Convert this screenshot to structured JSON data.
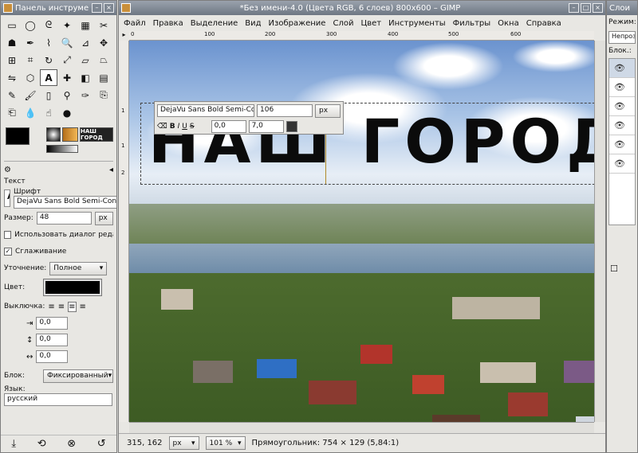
{
  "toolbox": {
    "title": "Панель инструме",
    "gradient_label": "НАШ ГОРОД",
    "options": {
      "section_title": "Текст",
      "font_label": "Шрифт",
      "font_value": "DejaVu Sans Bold Semi-Con",
      "size_label": "Размер:",
      "size_value": "48",
      "size_unit": "px",
      "use_dialog": "Использовать диалог редакт",
      "antialias": "Сглаживание",
      "hinting_label": "Уточнение:",
      "hinting_value": "Полное",
      "color_label": "Цвет:",
      "justify_label": "Выключка:",
      "indent_value": "0,0",
      "line_spacing_value": "0,0",
      "letter_spacing_value": "0,0",
      "box_label": "Блок:",
      "box_value": "Фиксированный",
      "language_label": "Язык:",
      "language_value": "русский"
    }
  },
  "image_window": {
    "title": "*Без имени-4.0 (Цвета RGB, 6 слоев) 800x600 – GIMP",
    "menu": [
      "Файл",
      "Правка",
      "Выделение",
      "Вид",
      "Изображение",
      "Слой",
      "Цвет",
      "Инструменты",
      "Фильтры",
      "Окна",
      "Справка"
    ],
    "ruler_ticks": [
      "0",
      "100",
      "200",
      "300",
      "400",
      "500",
      "600"
    ],
    "ruler_v_ticks": [
      "1",
      "1",
      "2"
    ],
    "canvas_text": "НАШ ГОРОД",
    "text_toolbar": {
      "font": "DejaVu Sans Bold Semi-Co",
      "size": "106",
      "unit": "px",
      "baseline": "0,0",
      "kerning": "7,0"
    },
    "status": {
      "coords": "315, 162",
      "unit": "px",
      "zoom": "101 %",
      "message": "Прямоугольник: 754 × 129  (5,84:1)"
    }
  },
  "layers_panel": {
    "title": "Слои",
    "mode_label": "Режим:",
    "opacity_label": "Непрозра",
    "lock_label": "Блок.:"
  }
}
